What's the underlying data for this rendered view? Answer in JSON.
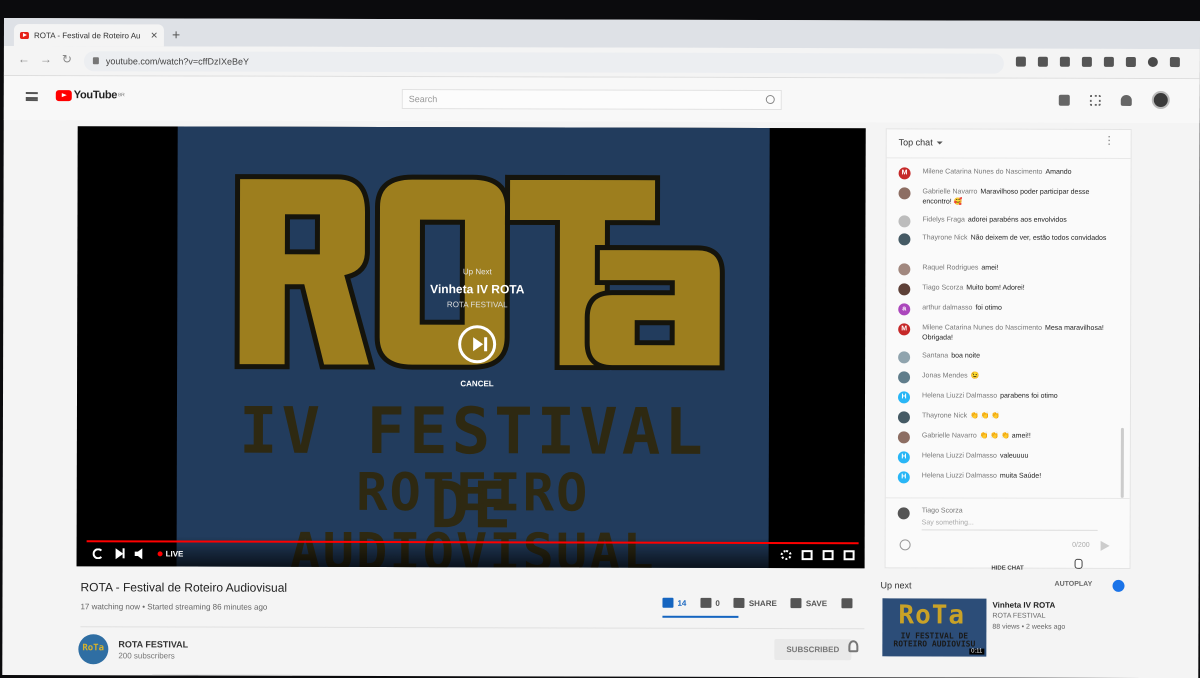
{
  "browser": {
    "tab_title": "ROTA - Festival de Roteiro Au",
    "tab_close": "✕",
    "new_tab": "+",
    "url": "youtube.com/watch?v=cffDzIXeBeY"
  },
  "youtube": {
    "logo_text": "YouTube",
    "logo_sup": "BR",
    "search_placeholder": "Search"
  },
  "player": {
    "upnext_label": "Up Next",
    "upnext_title": "Vinheta IV ROTA",
    "upnext_channel": "ROTA FESTIVAL",
    "cancel_label": "CANCEL",
    "live_label": "LIVE",
    "video_line1": "IV  FESTIVAL  DE",
    "video_line2": "ROTEIRO AUDIOVISUAL",
    "rota_logo": "ROTa"
  },
  "video": {
    "title": "ROTA - Festival de Roteiro Audiovisual",
    "meta": "17 watching now • Started streaming 86 minutes ago",
    "likes": "14",
    "dislikes": "0",
    "share_label": "SHARE",
    "save_label": "SAVE"
  },
  "channel": {
    "name": "ROTA FESTIVAL",
    "subs": "200 subscribers",
    "subscribed_label": "SUBSCRIBED",
    "avatar_text": "RoTa"
  },
  "chat": {
    "header": "Top chat",
    "messages": [
      {
        "author": "Milene Catarina Nunes do Nascimento",
        "text": "Amando",
        "initial": "M",
        "color": "#c62828"
      },
      {
        "author": "Gabrielle Navarro",
        "text": "Maravilhoso poder participar desse encontro! 🥰",
        "initial": "",
        "color": "#8d6e63"
      },
      {
        "author": "Fidelys Fraga",
        "text": "adorei parabéns aos envolvidos",
        "initial": "",
        "color": "#bdbdbd"
      },
      {
        "author": "Thayrone Nick",
        "text": "Não deixem de ver, estão todos convidados",
        "initial": "",
        "color": "#455a64"
      },
      {
        "author": "Raquel Rodrigues",
        "text": "amei!",
        "initial": "",
        "color": "#a1887f"
      },
      {
        "author": "Tiago Scorza",
        "text": "Muito bom! Adorei!",
        "initial": "",
        "color": "#5d4037"
      },
      {
        "author": "arthur dalmasso",
        "text": "foi otimo",
        "initial": "a",
        "color": "#ab47bc"
      },
      {
        "author": "Milene Catarina Nunes do Nascimento",
        "text": "Mesa maravilhosa! Obrigada!",
        "initial": "M",
        "color": "#c62828"
      },
      {
        "author": "Santana",
        "text": "boa noite",
        "initial": "",
        "color": "#90a4ae"
      },
      {
        "author": "Jonas Mendes",
        "text": "😉",
        "initial": "",
        "color": "#607d8b"
      },
      {
        "author": "Helena Liuzzi Dalmasso",
        "text": "parabens foi otimo",
        "initial": "H",
        "color": "#29b6f6"
      },
      {
        "author": "Thayrone Nick",
        "text": "👏 👏 👏",
        "initial": "",
        "color": "#455a64"
      },
      {
        "author": "Gabrielle Navarro",
        "text": "👏 👏 👏 amei!!",
        "initial": "",
        "color": "#8d6e63"
      },
      {
        "author": "Helena Liuzzi Dalmasso",
        "text": "valeuuuu",
        "initial": "H",
        "color": "#29b6f6"
      },
      {
        "author": "Helena Liuzzi Dalmasso",
        "text": "muita Saúde!",
        "initial": "H",
        "color": "#29b6f6"
      }
    ],
    "input_name": "Tiago Scorza",
    "input_placeholder": "Say something...",
    "counter": "0/200",
    "hide_label": "HIDE CHAT"
  },
  "upnext_side": {
    "label": "Up next",
    "autoplay_label": "AUTOPLAY",
    "title": "Vinheta IV ROTA",
    "channel": "ROTA FESTIVAL",
    "meta": "88 views • 2 weeks ago",
    "thumb_logo": "RoTa",
    "thumb_line1": "IV FESTIVAL DE",
    "thumb_line2": "ROTEIRO AUDIOVISU",
    "duration": "0:11"
  },
  "colors": {
    "accent_red": "#ff0000",
    "like_blue": "#1565c0",
    "rota_yellow": "#c9a227",
    "video_blue": "#2c4d78"
  }
}
